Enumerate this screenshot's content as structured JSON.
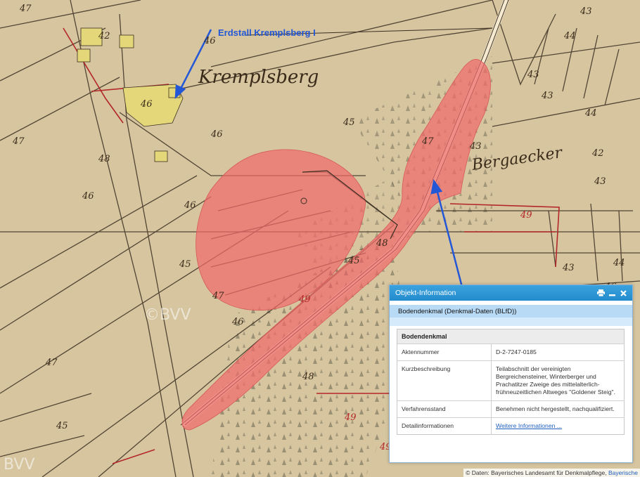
{
  "map": {
    "place_name": "Kremplsberg",
    "field_name": "Bergaecker",
    "annotation": "Erdstall Kremplsberg I",
    "watermark": "©BVV",
    "watermark2": "BVV",
    "parcels": [
      "47",
      "42",
      "46",
      "46",
      "45",
      "46",
      "47",
      "45",
      "46",
      "46",
      "45",
      "47",
      "46",
      "49",
      "48",
      "47",
      "43",
      "44",
      "43",
      "43",
      "43",
      "44",
      "42",
      "43",
      "49",
      "49",
      "43",
      "48",
      "47",
      "44",
      "46",
      "45",
      "49",
      "48"
    ],
    "colors": {
      "paper": "#d9c9a3",
      "highlight": "#ef6b6b",
      "annotation": "#2357d6",
      "parcel_red": "#b3262a"
    }
  },
  "popup": {
    "title": "Objekt-Information",
    "subtitle": "Bodendenkmal (Denkmal-Daten (BLfD))",
    "section": "Bodendenkmal",
    "rows": [
      {
        "key": "Aktennummer",
        "value": "D-2-7247-0185"
      },
      {
        "key": "Kurzbeschreibung",
        "value": "Teilabschnitt der vereinigten Bergreichensteiner, Winterberger und Prachatitzer Zweige des mittelalterlich-frühneuzeitlichen Altweges \"Goldener Steig\"."
      },
      {
        "key": "Verfahrensstand",
        "value": "Benehmen nicht hergestellt, nachqualifiziert."
      }
    ],
    "details_key": "Detailinformationen",
    "details_link": "Weitere Informationen ...",
    "header_colors": [
      "#3aa3de",
      "#238bcc"
    ]
  },
  "attribution": {
    "text": "© Daten: Bayerisches Landesamt für Denkmalpflege,",
    "link": "Bayerische"
  }
}
